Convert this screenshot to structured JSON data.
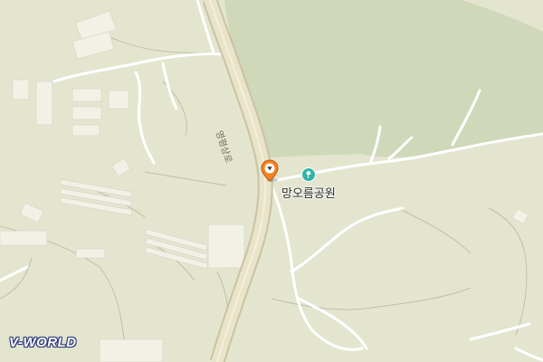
{
  "map": {
    "provider_logo": "V-WORLD",
    "colors": {
      "land": "#e4e5cf",
      "forest": "#cfd8b9",
      "road_main_fill": "#e9e4c9",
      "road_main_casing": "#c9c3a4",
      "path": "#ffffff",
      "building": "#f1f1e6",
      "marker": "#f58220",
      "poi_icon": "#2db5a7"
    },
    "labels": {
      "road_name": "영평상로",
      "poi_name": "망오름공원"
    },
    "icons": {
      "poi": "park-icon",
      "marker": "location-pin-icon"
    }
  }
}
